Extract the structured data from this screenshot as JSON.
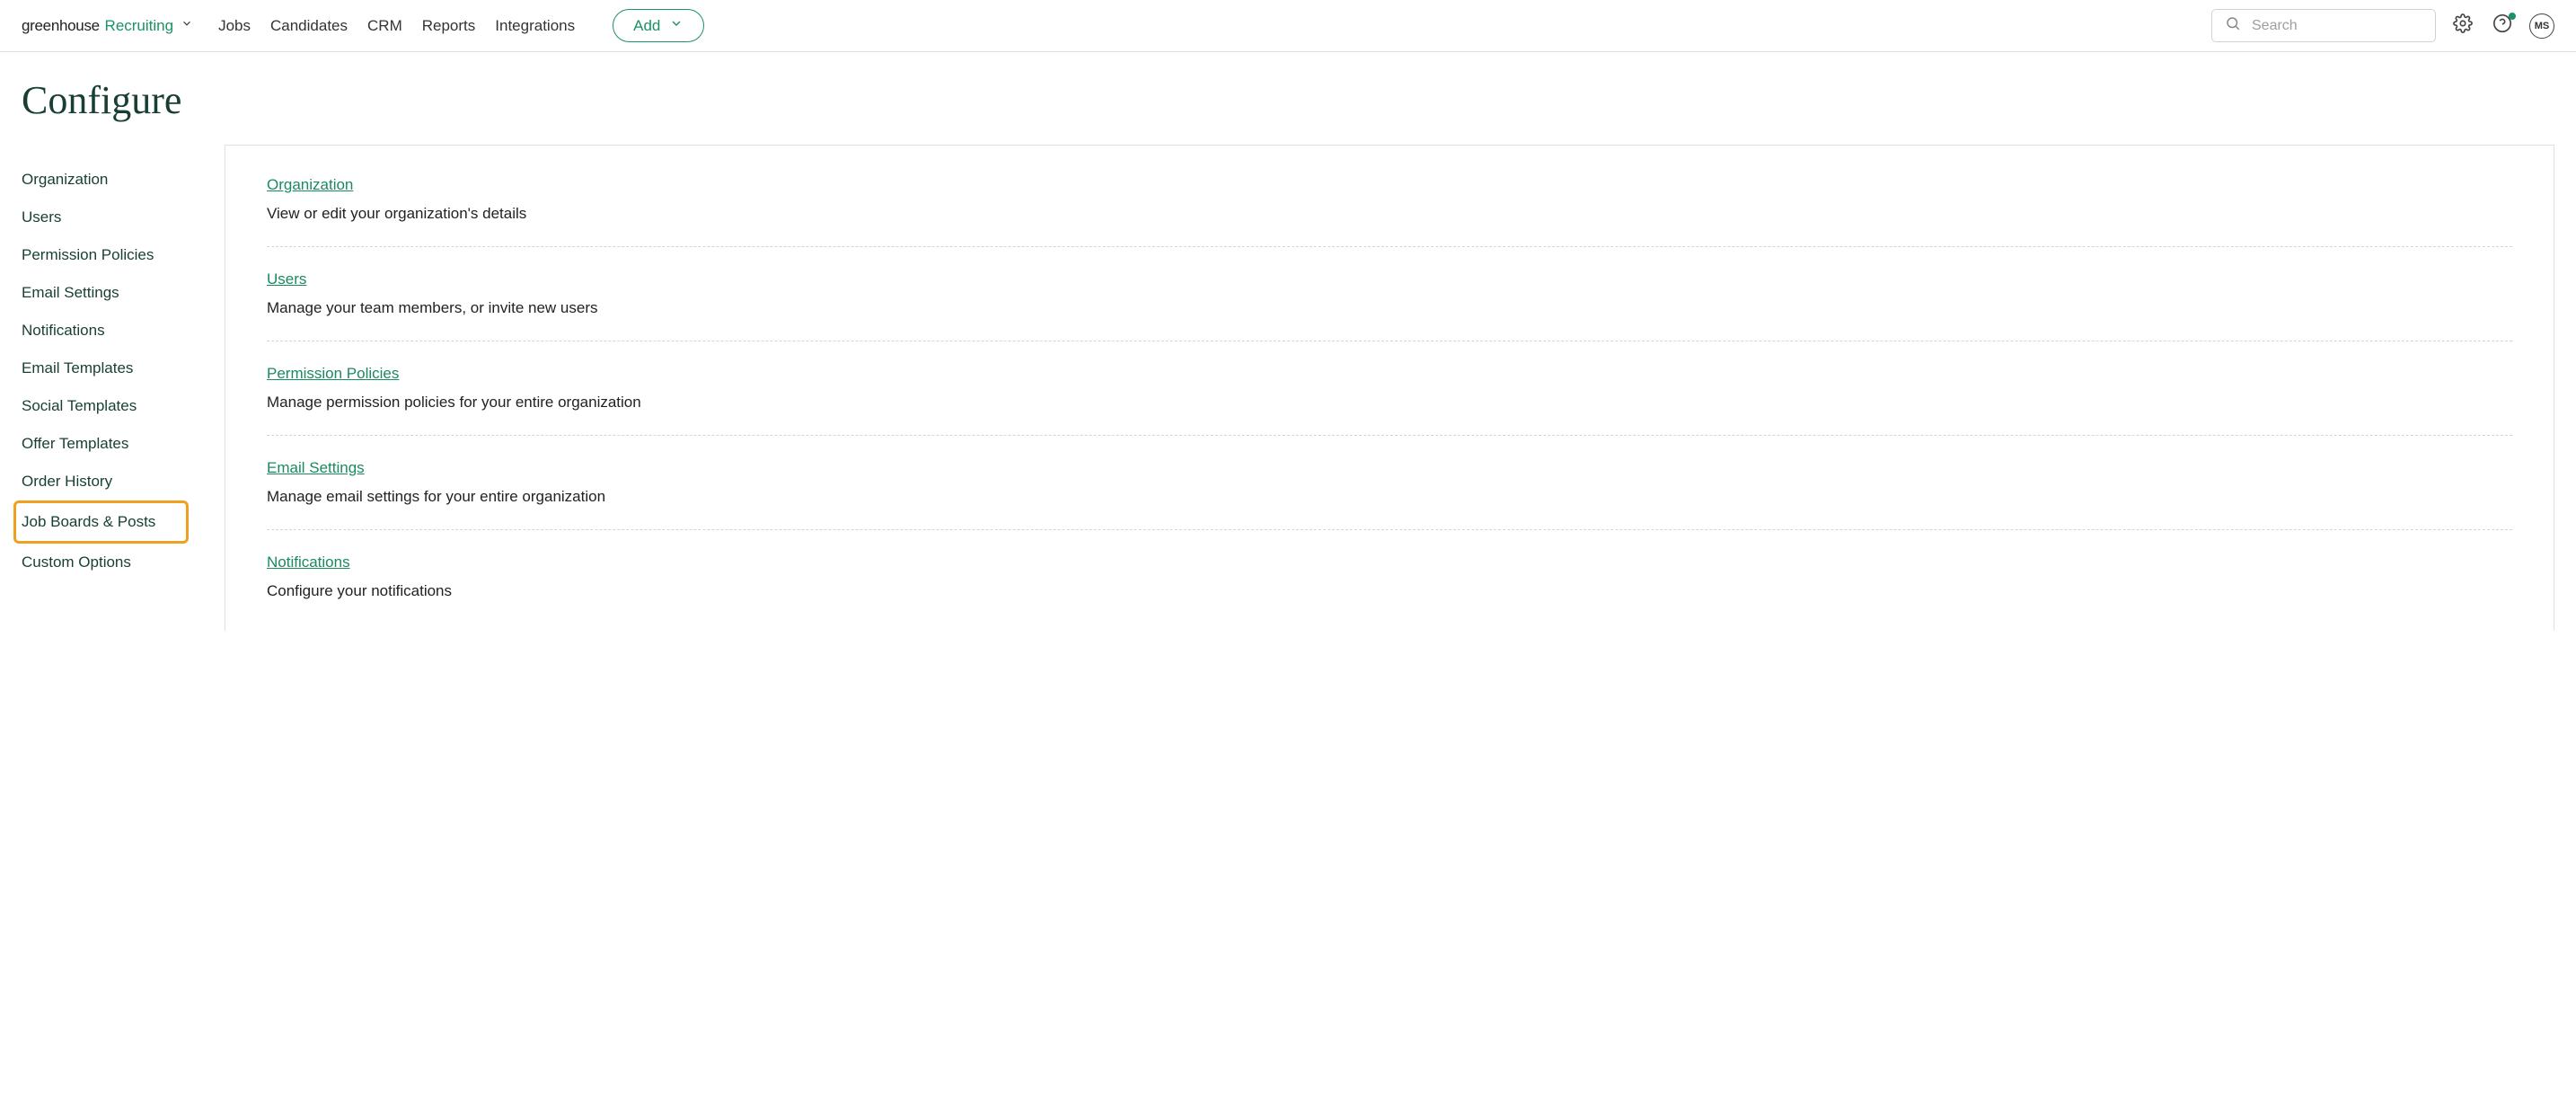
{
  "logo": {
    "part1": "greenhouse",
    "part2": " Recruiting"
  },
  "nav": {
    "items": [
      "Jobs",
      "Candidates",
      "CRM",
      "Reports",
      "Integrations"
    ],
    "add_label": "Add"
  },
  "search": {
    "placeholder": "Search"
  },
  "avatar_initials": "MS",
  "page_title": "Configure",
  "sidebar": {
    "items": [
      "Organization",
      "Users",
      "Permission Policies",
      "Email Settings",
      "Notifications",
      "Email Templates",
      "Social Templates",
      "Offer Templates",
      "Order History",
      "Job Boards & Posts",
      "Custom Options"
    ],
    "highlighted_index": 9
  },
  "content": {
    "rows": [
      {
        "title": "Organization",
        "desc": "View or edit your organization's details"
      },
      {
        "title": "Users",
        "desc": "Manage your team members, or invite new users"
      },
      {
        "title": "Permission Policies",
        "desc": "Manage permission policies for your entire organization"
      },
      {
        "title": "Email Settings",
        "desc": "Manage email settings for your entire organization"
      },
      {
        "title": "Notifications",
        "desc": "Configure your notifications"
      }
    ]
  }
}
